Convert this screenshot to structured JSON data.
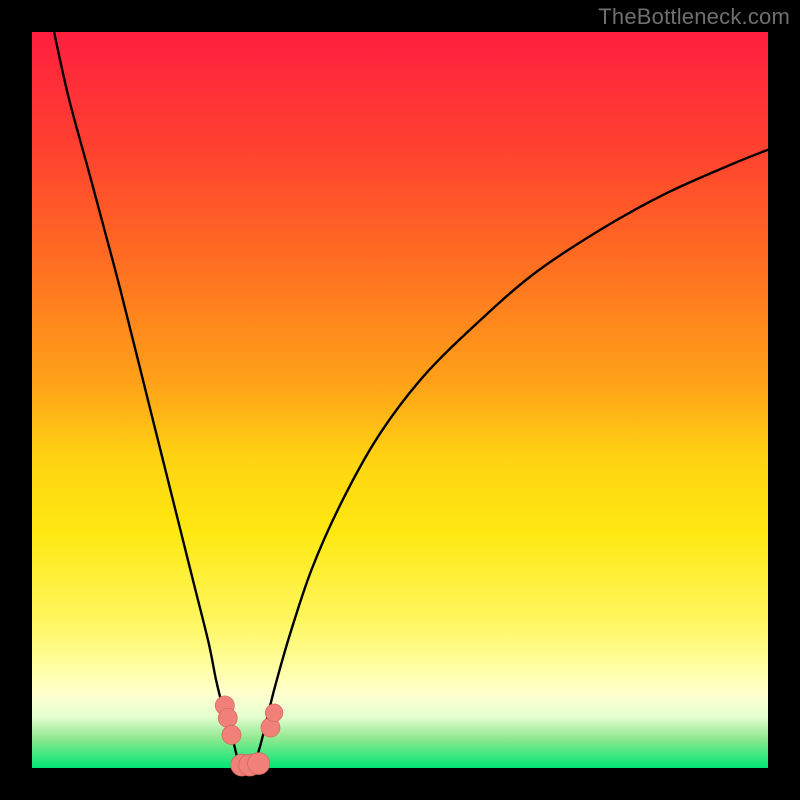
{
  "watermark": "TheBottleneck.com",
  "colors": {
    "frame": "#000000",
    "curve": "#000000",
    "marker_fill": "#f08078",
    "marker_stroke": "#d06058"
  },
  "chart_data": {
    "type": "line",
    "title": "",
    "xlabel": "",
    "ylabel": "",
    "xlim": [
      0,
      100
    ],
    "ylim": [
      0,
      100
    ],
    "grid": false,
    "legend": false,
    "series": [
      {
        "name": "bottleneck-curve",
        "x": [
          3,
          5,
          8,
          12,
          16,
          20,
          22,
          24,
          25,
          26,
          27,
          27.5,
          28,
          28.5,
          29,
          29.5,
          30,
          31,
          32,
          33,
          35,
          38,
          42,
          47,
          53,
          60,
          68,
          77,
          86,
          95,
          100
        ],
        "y": [
          100,
          91,
          80,
          65,
          49,
          33,
          25,
          17,
          12,
          8,
          5,
          3,
          1,
          0,
          0,
          0,
          0,
          3,
          7,
          11,
          18,
          27,
          36,
          45,
          53,
          60,
          67,
          73,
          78,
          82,
          84
        ]
      }
    ],
    "markers": [
      {
        "name": "pt-left-1",
        "x": 26.2,
        "y": 8.5,
        "r": 1.3
      },
      {
        "name": "pt-left-2",
        "x": 26.6,
        "y": 6.8,
        "r": 1.3
      },
      {
        "name": "pt-left-3",
        "x": 27.1,
        "y": 4.5,
        "r": 1.3
      },
      {
        "name": "pt-bottom-1",
        "x": 28.5,
        "y": 0.4,
        "r": 1.5
      },
      {
        "name": "pt-bottom-2",
        "x": 29.6,
        "y": 0.4,
        "r": 1.5
      },
      {
        "name": "pt-bottom-3",
        "x": 30.8,
        "y": 0.6,
        "r": 1.5
      },
      {
        "name": "pt-right-1",
        "x": 32.4,
        "y": 5.5,
        "r": 1.3
      },
      {
        "name": "pt-right-2",
        "x": 32.9,
        "y": 7.5,
        "r": 1.2
      }
    ]
  }
}
